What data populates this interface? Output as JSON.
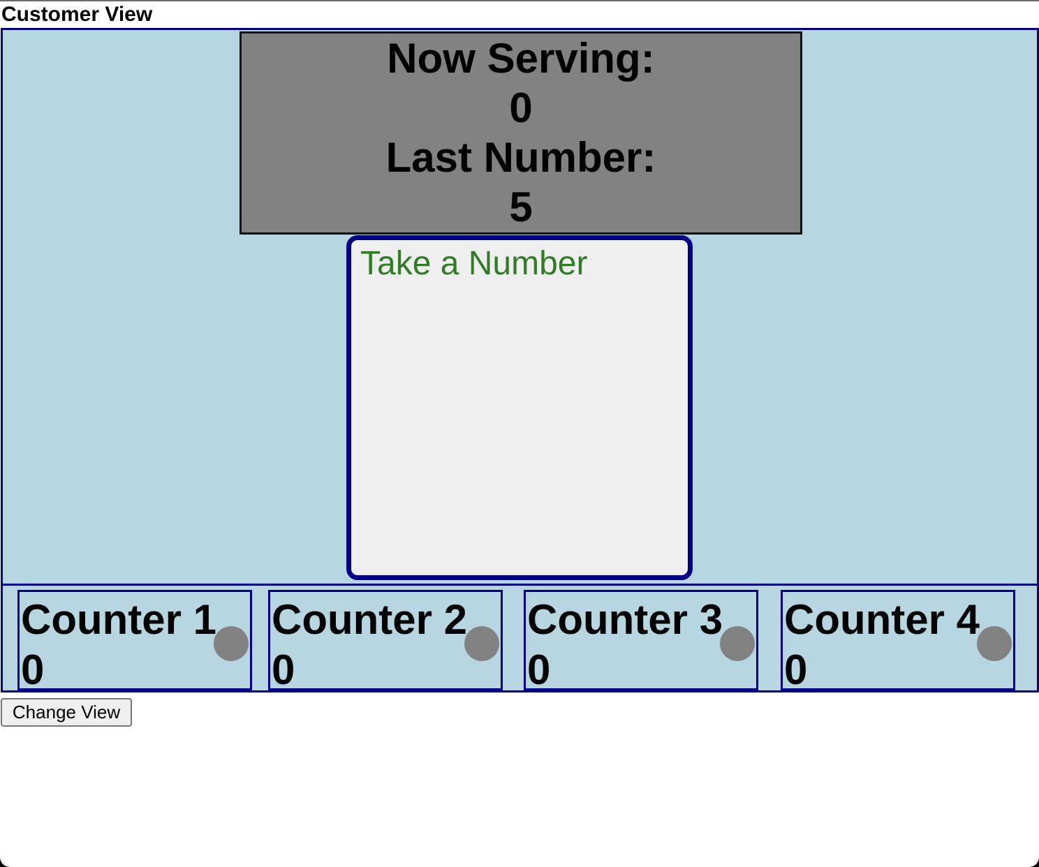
{
  "page": {
    "title": "Customer View"
  },
  "display": {
    "now_serving_label": "Now Serving:",
    "now_serving_value": "0",
    "last_number_label": "Last Number:",
    "last_number_value": "5"
  },
  "take_number": {
    "label": "Take a Number"
  },
  "counters": [
    {
      "title": "Counter 1",
      "value": "0"
    },
    {
      "title": "Counter 2",
      "value": "0"
    },
    {
      "title": "Counter 3",
      "value": "0"
    },
    {
      "title": "Counter 4",
      "value": "0"
    }
  ],
  "actions": {
    "change_view_label": "Change View"
  },
  "colors": {
    "panel_background": "#b6d7e2",
    "border_navy": "#000085",
    "display_gray": "#828282",
    "take_number_text": "#2e7d23",
    "indicator_gray": "#828282"
  }
}
